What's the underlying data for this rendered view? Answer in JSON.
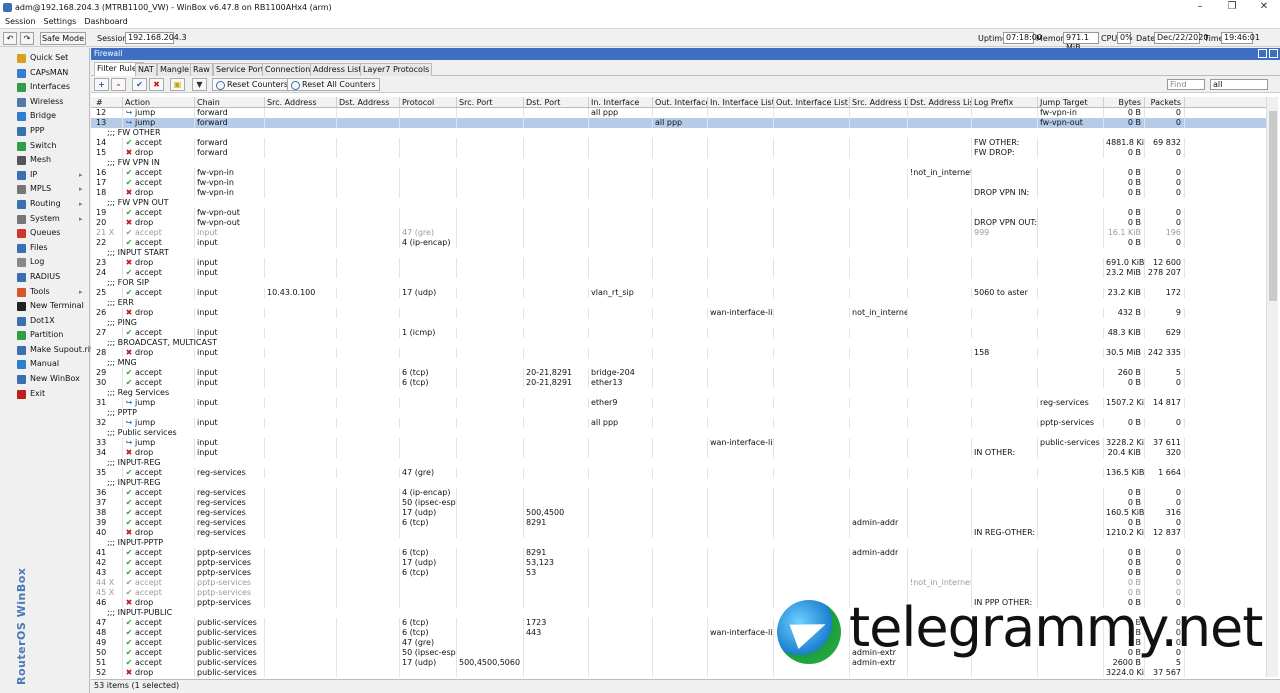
{
  "window": {
    "title": "adm@192.168.204.3 (MTRB1100_VW) - WinBox v6.47.8 on RB1100AHx4 (arm)"
  },
  "menu": [
    "Session",
    "Settings",
    "Dashboard"
  ],
  "toolbar": {
    "safe_mode": "Safe Mode",
    "session_label": "Session:",
    "session_value": "192.168.204.3",
    "uptime_label": "Uptime:",
    "uptime": "07:18:00",
    "memory_label": "Memory:",
    "memory": "971.1 MiB",
    "cpu_label": "CPU:",
    "cpu": "0%",
    "date_label": "Date:",
    "date": "Dec/22/2020",
    "time_label": "Time:",
    "time": "19:46:01"
  },
  "sidebar": {
    "brand": "RouterOS WinBox",
    "items": [
      {
        "label": "Quick Set",
        "icon": "quickset-icon",
        "color": "#d9a020",
        "sub": false
      },
      {
        "label": "CAPsMAN",
        "icon": "capsman-icon",
        "color": "#3a7bd0",
        "sub": false
      },
      {
        "label": "Interfaces",
        "icon": "interfaces-icon",
        "color": "#2f9e44",
        "sub": false
      },
      {
        "label": "Wireless",
        "icon": "wireless-icon",
        "color": "#5577aa",
        "sub": false
      },
      {
        "label": "Bridge",
        "icon": "bridge-icon",
        "color": "#2f7fd0",
        "sub": false
      },
      {
        "label": "PPP",
        "icon": "ppp-icon",
        "color": "#3a6fb0",
        "sub": false
      },
      {
        "label": "Switch",
        "icon": "switch-icon",
        "color": "#2f9e44",
        "sub": false
      },
      {
        "label": "Mesh",
        "icon": "mesh-icon",
        "color": "#555",
        "sub": false
      },
      {
        "label": "IP",
        "icon": "ip-icon",
        "color": "#3a6fb0",
        "sub": true
      },
      {
        "label": "MPLS",
        "icon": "mpls-icon",
        "color": "#777",
        "sub": true
      },
      {
        "label": "Routing",
        "icon": "routing-icon",
        "color": "#3a6fb0",
        "sub": true
      },
      {
        "label": "System",
        "icon": "system-icon",
        "color": "#777",
        "sub": true
      },
      {
        "label": "Queues",
        "icon": "queues-icon",
        "color": "#d0342c",
        "sub": false
      },
      {
        "label": "Files",
        "icon": "files-icon",
        "color": "#3a6fb0",
        "sub": false
      },
      {
        "label": "Log",
        "icon": "log-icon",
        "color": "#888",
        "sub": false
      },
      {
        "label": "RADIUS",
        "icon": "radius-icon",
        "color": "#3a6fb0",
        "sub": false
      },
      {
        "label": "Tools",
        "icon": "tools-icon",
        "color": "#d05a2c",
        "sub": true
      },
      {
        "label": "New Terminal",
        "icon": "terminal-icon",
        "color": "#222",
        "sub": false
      },
      {
        "label": "Dot1X",
        "icon": "dot1x-icon",
        "color": "#3a6fb0",
        "sub": false
      },
      {
        "label": "Partition",
        "icon": "partition-icon",
        "color": "#2f9e44",
        "sub": false
      },
      {
        "label": "Make Supout.rif",
        "icon": "supout-icon",
        "color": "#3a6fb0",
        "sub": false
      },
      {
        "label": "Manual",
        "icon": "manual-icon",
        "color": "#2f7fd0",
        "sub": false
      },
      {
        "label": "New WinBox",
        "icon": "winbox-icon",
        "color": "#3a6fb0",
        "sub": false
      },
      {
        "label": "Exit",
        "icon": "exit-icon",
        "color": "#c01d1d",
        "sub": false
      }
    ]
  },
  "firewall": {
    "title": "Firewall",
    "tabs": [
      "Filter Rules",
      "NAT",
      "Mangle",
      "Raw",
      "Service Ports",
      "Connections",
      "Address Lists",
      "Layer7 Protocols"
    ],
    "reset_counters": "Reset Counters",
    "reset_all": "Reset All Counters",
    "find_placeholder": "Find",
    "filter_value": "all",
    "columns": [
      "#",
      "Action",
      "Chain",
      "Src. Address",
      "Dst. Address",
      "Protocol",
      "Src. Port",
      "Dst. Port",
      "In. Interface",
      "Out. Interface",
      "In. Interface List",
      "Out. Interface List",
      "Src. Address List",
      "Dst. Address List",
      "Log Prefix",
      "Jump Target",
      "Bytes",
      "Packets"
    ],
    "rows": [
      [
        "12",
        "jump",
        "forward",
        "",
        "",
        "",
        "",
        "",
        "all ppp",
        "",
        "",
        "",
        "",
        "",
        "",
        "fw-vpn-in",
        "0 B",
        "0"
      ],
      [
        "13",
        "jump",
        "forward",
        "",
        "",
        "",
        "",
        "",
        "",
        "all ppp",
        "",
        "",
        "",
        "",
        "",
        "fw-vpn-out",
        "0 B",
        "0",
        "sel"
      ],
      [
        "c",
        ";;; FW OTHER"
      ],
      [
        "14",
        "accept",
        "forward",
        "",
        "",
        "",
        "",
        "",
        "",
        "",
        "",
        "",
        "",
        "",
        "FW OTHER:",
        "",
        "4881.8 KiB",
        "69 832"
      ],
      [
        "15",
        "drop",
        "forward",
        "",
        "",
        "",
        "",
        "",
        "",
        "",
        "",
        "",
        "",
        "",
        "FW DROP:",
        "",
        "0 B",
        "0"
      ],
      [
        "c",
        ";;; FW VPN IN"
      ],
      [
        "16",
        "accept",
        "fw-vpn-in",
        "",
        "",
        "",
        "",
        "",
        "",
        "",
        "",
        "",
        "",
        "!not_in_internet",
        "",
        "",
        "0 B",
        "0"
      ],
      [
        "17",
        "accept",
        "fw-vpn-in",
        "",
        "",
        "",
        "",
        "",
        "",
        "",
        "",
        "",
        "",
        "",
        "",
        "",
        "0 B",
        "0"
      ],
      [
        "18",
        "drop",
        "fw-vpn-in",
        "",
        "",
        "",
        "",
        "",
        "",
        "",
        "",
        "",
        "",
        "",
        "DROP VPN IN:",
        "",
        "0 B",
        "0"
      ],
      [
        "c",
        ";;; FW VPN OUT"
      ],
      [
        "19",
        "accept",
        "fw-vpn-out",
        "",
        "",
        "",
        "",
        "",
        "",
        "",
        "",
        "",
        "",
        "",
        "",
        "",
        "0 B",
        "0"
      ],
      [
        "20",
        "drop",
        "fw-vpn-out",
        "",
        "",
        "",
        "",
        "",
        "",
        "",
        "",
        "",
        "",
        "",
        "DROP VPN OUT:",
        "",
        "0 B",
        "0"
      ],
      [
        "21 X",
        "accept",
        "input",
        "",
        "",
        "47 (gre)",
        "",
        "",
        "",
        "",
        "",
        "",
        "",
        "",
        "999",
        "",
        "16.1 KiB",
        "196",
        "dis"
      ],
      [
        "22",
        "accept",
        "input",
        "",
        "",
        "4 (ip-encap)",
        "",
        "",
        "",
        "",
        "",
        "",
        "",
        "",
        "",
        "",
        "0 B",
        "0"
      ],
      [
        "c",
        ";;; INPUT START"
      ],
      [
        "23",
        "drop",
        "input",
        "",
        "",
        "",
        "",
        "",
        "",
        "",
        "",
        "",
        "",
        "",
        "",
        "",
        "691.0 KiB",
        "12 600"
      ],
      [
        "24",
        "accept",
        "input",
        "",
        "",
        "",
        "",
        "",
        "",
        "",
        "",
        "",
        "",
        "",
        "",
        "",
        "23.2 MiB",
        "278 207"
      ],
      [
        "c",
        ";;; FOR SIP"
      ],
      [
        "25",
        "accept",
        "input",
        "10.43.0.100",
        "",
        "17 (udp)",
        "",
        "",
        "vlan_rt_sip",
        "",
        "",
        "",
        "",
        "",
        "5060 to aster",
        "",
        "23.2 KiB",
        "172"
      ],
      [
        "c",
        ";;; ERR"
      ],
      [
        "26",
        "drop",
        "input",
        "",
        "",
        "",
        "",
        "",
        "",
        "",
        "wan-interface-list",
        "",
        "not_in_internet",
        "",
        "",
        "",
        "432 B",
        "9"
      ],
      [
        "c",
        ";;; PING"
      ],
      [
        "27",
        "accept",
        "input",
        "",
        "",
        "1 (icmp)",
        "",
        "",
        "",
        "",
        "",
        "",
        "",
        "",
        "",
        "",
        "48.3 KiB",
        "629"
      ],
      [
        "c",
        ";;; BROADCAST, MULTICAST"
      ],
      [
        "28",
        "drop",
        "input",
        "",
        "",
        "",
        "",
        "",
        "",
        "",
        "",
        "",
        "",
        "",
        "158",
        "",
        "30.5 MiB",
        "242 335"
      ],
      [
        "c",
        ";;; MNG"
      ],
      [
        "29",
        "accept",
        "input",
        "",
        "",
        "6 (tcp)",
        "",
        "20-21,8291",
        "bridge-204",
        "",
        "",
        "",
        "",
        "",
        "",
        "",
        "260 B",
        "5"
      ],
      [
        "30",
        "accept",
        "input",
        "",
        "",
        "6 (tcp)",
        "",
        "20-21,8291",
        "ether13",
        "",
        "",
        "",
        "",
        "",
        "",
        "",
        "0 B",
        "0"
      ],
      [
        "c",
        ";;; Reg Services"
      ],
      [
        "31",
        "jump",
        "input",
        "",
        "",
        "",
        "",
        "",
        "ether9",
        "",
        "",
        "",
        "",
        "",
        "",
        "reg-services",
        "1507.2 KiB",
        "14 817"
      ],
      [
        "c",
        ";;; PPTP"
      ],
      [
        "32",
        "jump",
        "input",
        "",
        "",
        "",
        "",
        "",
        "all ppp",
        "",
        "",
        "",
        "",
        "",
        "",
        "pptp-services",
        "0 B",
        "0"
      ],
      [
        "c",
        ";;; Public services"
      ],
      [
        "33",
        "jump",
        "input",
        "",
        "",
        "",
        "",
        "",
        "",
        "",
        "wan-interface-list",
        "",
        "",
        "",
        "",
        "public-services",
        "3228.2 KiB",
        "37 611"
      ],
      [
        "34",
        "drop",
        "input",
        "",
        "",
        "",
        "",
        "",
        "",
        "",
        "",
        "",
        "",
        "",
        "IN OTHER:",
        "",
        "20.4 KiB",
        "320"
      ],
      [
        "c",
        ";;; INPUT-REG"
      ],
      [
        "35",
        "accept",
        "reg-services",
        "",
        "",
        "47 (gre)",
        "",
        "",
        "",
        "",
        "",
        "",
        "",
        "",
        "",
        "",
        "136.5 KiB",
        "1 664"
      ],
      [
        "c",
        ";;; INPUT-REG"
      ],
      [
        "36",
        "accept",
        "reg-services",
        "",
        "",
        "4 (ip-encap)",
        "",
        "",
        "",
        "",
        "",
        "",
        "",
        "",
        "",
        "",
        "0 B",
        "0"
      ],
      [
        "37",
        "accept",
        "reg-services",
        "",
        "",
        "50 (ipsec-esp)",
        "",
        "",
        "",
        "",
        "",
        "",
        "",
        "",
        "",
        "",
        "0 B",
        "0"
      ],
      [
        "38",
        "accept",
        "reg-services",
        "",
        "",
        "17 (udp)",
        "",
        "500,4500",
        "",
        "",
        "",
        "",
        "",
        "",
        "",
        "",
        "160.5 KiB",
        "316"
      ],
      [
        "39",
        "accept",
        "reg-services",
        "",
        "",
        "6 (tcp)",
        "",
        "8291",
        "",
        "",
        "",
        "",
        "admin-addr",
        "",
        "",
        "",
        "0 B",
        "0"
      ],
      [
        "40",
        "drop",
        "reg-services",
        "",
        "",
        "",
        "",
        "",
        "",
        "",
        "",
        "",
        "",
        "",
        "IN REG-OTHER:",
        "",
        "1210.2 KiB",
        "12 837"
      ],
      [
        "c",
        ";;; INPUT-PPTP"
      ],
      [
        "41",
        "accept",
        "pptp-services",
        "",
        "",
        "6 (tcp)",
        "",
        "8291",
        "",
        "",
        "",
        "",
        "admin-addr",
        "",
        "",
        "",
        "0 B",
        "0"
      ],
      [
        "42",
        "accept",
        "pptp-services",
        "",
        "",
        "17 (udp)",
        "",
        "53,123",
        "",
        "",
        "",
        "",
        "",
        "",
        "",
        "",
        "0 B",
        "0"
      ],
      [
        "43",
        "accept",
        "pptp-services",
        "",
        "",
        "6 (tcp)",
        "",
        "53",
        "",
        "",
        "",
        "",
        "",
        "",
        "",
        "",
        "0 B",
        "0"
      ],
      [
        "44 X",
        "accept",
        "pptp-services",
        "",
        "",
        "",
        "",
        "",
        "",
        "",
        "",
        "",
        "",
        "!not_in_internet",
        "",
        "",
        "0 B",
        "0",
        "dis"
      ],
      [
        "45 X",
        "accept",
        "pptp-services",
        "",
        "",
        "",
        "",
        "",
        "",
        "",
        "",
        "",
        "",
        "",
        "",
        "",
        "0 B",
        "0",
        "dis"
      ],
      [
        "46",
        "drop",
        "pptp-services",
        "",
        "",
        "",
        "",
        "",
        "",
        "",
        "",
        "",
        "",
        "",
        "IN PPP OTHER:",
        "",
        "0 B",
        "0"
      ],
      [
        "c",
        ";;; INPUT-PUBLIC"
      ],
      [
        "47",
        "accept",
        "public-services",
        "",
        "",
        "6 (tcp)",
        "",
        "1723",
        "",
        "",
        "",
        "",
        "",
        "",
        "",
        "",
        "0 B",
        "0"
      ],
      [
        "48",
        "accept",
        "public-services",
        "",
        "",
        "6 (tcp)",
        "",
        "443",
        "",
        "",
        "wan-interface-list",
        "",
        "",
        "",
        "",
        "",
        "0 B",
        "0"
      ],
      [
        "49",
        "accept",
        "public-services",
        "",
        "",
        "47 (gre)",
        "",
        "",
        "",
        "",
        "",
        "",
        "",
        "",
        "",
        "",
        "0 B",
        "0"
      ],
      [
        "50",
        "accept",
        "public-services",
        "",
        "",
        "50 (ipsec-esp)",
        "",
        "",
        "",
        "",
        "",
        "",
        "admin-extr",
        "",
        "",
        "",
        "0 B",
        "0"
      ],
      [
        "51",
        "accept",
        "public-services",
        "",
        "",
        "17 (udp)",
        "500,4500,5060",
        "",
        "",
        "",
        "",
        "",
        "admin-extr",
        "",
        "",
        "",
        "2600 B",
        "5"
      ],
      [
        "52",
        "drop",
        "public-services",
        "",
        "",
        "",
        "",
        "",
        "",
        "",
        "",
        "",
        "",
        "",
        "",
        "",
        "3224.0 KiB",
        "37 567"
      ]
    ],
    "status": "53 items (1 selected)"
  },
  "watermark": "telegrammy.net"
}
